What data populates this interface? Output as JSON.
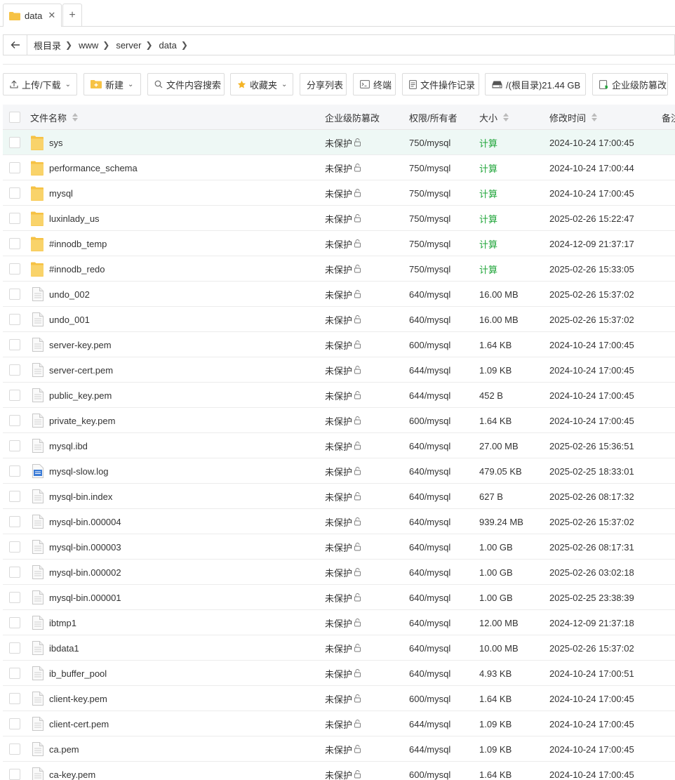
{
  "tab": {
    "label": "data",
    "close": "✕",
    "add": "+"
  },
  "breadcrumb": [
    "根目录",
    "www",
    "server",
    "data"
  ],
  "toolbar": {
    "upload": "上传/下载",
    "create": "新建",
    "search_content": "文件内容搜索",
    "favorites": "收藏夹",
    "share_list": "分享列表",
    "terminal": "终端",
    "operation_log": "文件操作记录",
    "disk": "/(根目录)21.44 GB",
    "tamper": "企业级防篡改"
  },
  "columns": {
    "name": "文件名称",
    "protection": "企业级防篡改",
    "permission": "权限/所有者",
    "size": "大小",
    "modified": "修改时间",
    "note": "备注"
  },
  "colors": {
    "accent": "#20a53a",
    "folder": "#f6c244",
    "selected_row": "#eef8f5"
  },
  "files": [
    {
      "name": "sys",
      "type": "folder",
      "protection": "未保护",
      "permission": "750/mysql",
      "size": "计算",
      "modified": "2024-10-24 17:00:45"
    },
    {
      "name": "performance_schema",
      "type": "folder",
      "protection": "未保护",
      "permission": "750/mysql",
      "size": "计算",
      "modified": "2024-10-24 17:00:44"
    },
    {
      "name": "mysql",
      "type": "folder",
      "protection": "未保护",
      "permission": "750/mysql",
      "size": "计算",
      "modified": "2024-10-24 17:00:45"
    },
    {
      "name": "luxinlady_us",
      "type": "folder",
      "protection": "未保护",
      "permission": "750/mysql",
      "size": "计算",
      "modified": "2025-02-26 15:22:47"
    },
    {
      "name": "#innodb_temp",
      "type": "folder",
      "protection": "未保护",
      "permission": "750/mysql",
      "size": "计算",
      "modified": "2024-12-09 21:37:17"
    },
    {
      "name": "#innodb_redo",
      "type": "folder",
      "protection": "未保护",
      "permission": "750/mysql",
      "size": "计算",
      "modified": "2025-02-26 15:33:05"
    },
    {
      "name": "undo_002",
      "type": "file",
      "protection": "未保护",
      "permission": "640/mysql",
      "size": "16.00 MB",
      "modified": "2025-02-26 15:37:02"
    },
    {
      "name": "undo_001",
      "type": "file",
      "protection": "未保护",
      "permission": "640/mysql",
      "size": "16.00 MB",
      "modified": "2025-02-26 15:37:02"
    },
    {
      "name": "server-key.pem",
      "type": "file",
      "protection": "未保护",
      "permission": "600/mysql",
      "size": "1.64 KB",
      "modified": "2024-10-24 17:00:45"
    },
    {
      "name": "server-cert.pem",
      "type": "file",
      "protection": "未保护",
      "permission": "644/mysql",
      "size": "1.09 KB",
      "modified": "2024-10-24 17:00:45"
    },
    {
      "name": "public_key.pem",
      "type": "file",
      "protection": "未保护",
      "permission": "644/mysql",
      "size": "452 B",
      "modified": "2024-10-24 17:00:45"
    },
    {
      "name": "private_key.pem",
      "type": "file",
      "protection": "未保护",
      "permission": "600/mysql",
      "size": "1.64 KB",
      "modified": "2024-10-24 17:00:45"
    },
    {
      "name": "mysql.ibd",
      "type": "file",
      "protection": "未保护",
      "permission": "640/mysql",
      "size": "27.00 MB",
      "modified": "2025-02-26 15:36:51"
    },
    {
      "name": "mysql-slow.log",
      "type": "log",
      "protection": "未保护",
      "permission": "640/mysql",
      "size": "479.05 KB",
      "modified": "2025-02-25 18:33:01"
    },
    {
      "name": "mysql-bin.index",
      "type": "file",
      "protection": "未保护",
      "permission": "640/mysql",
      "size": "627 B",
      "modified": "2025-02-26 08:17:32"
    },
    {
      "name": "mysql-bin.000004",
      "type": "file",
      "protection": "未保护",
      "permission": "640/mysql",
      "size": "939.24 MB",
      "modified": "2025-02-26 15:37:02"
    },
    {
      "name": "mysql-bin.000003",
      "type": "file",
      "protection": "未保护",
      "permission": "640/mysql",
      "size": "1.00 GB",
      "modified": "2025-02-26 08:17:31"
    },
    {
      "name": "mysql-bin.000002",
      "type": "file",
      "protection": "未保护",
      "permission": "640/mysql",
      "size": "1.00 GB",
      "modified": "2025-02-26 03:02:18"
    },
    {
      "name": "mysql-bin.000001",
      "type": "file",
      "protection": "未保护",
      "permission": "640/mysql",
      "size": "1.00 GB",
      "modified": "2025-02-25 23:38:39"
    },
    {
      "name": "ibtmp1",
      "type": "file",
      "protection": "未保护",
      "permission": "640/mysql",
      "size": "12.00 MB",
      "modified": "2024-12-09 21:37:18"
    },
    {
      "name": "ibdata1",
      "type": "file",
      "protection": "未保护",
      "permission": "640/mysql",
      "size": "10.00 MB",
      "modified": "2025-02-26 15:37:02"
    },
    {
      "name": "ib_buffer_pool",
      "type": "file",
      "protection": "未保护",
      "permission": "640/mysql",
      "size": "4.93 KB",
      "modified": "2024-10-24 17:00:51"
    },
    {
      "name": "client-key.pem",
      "type": "file",
      "protection": "未保护",
      "permission": "600/mysql",
      "size": "1.64 KB",
      "modified": "2024-10-24 17:00:45"
    },
    {
      "name": "client-cert.pem",
      "type": "file",
      "protection": "未保护",
      "permission": "644/mysql",
      "size": "1.09 KB",
      "modified": "2024-10-24 17:00:45"
    },
    {
      "name": "ca.pem",
      "type": "file",
      "protection": "未保护",
      "permission": "644/mysql",
      "size": "1.09 KB",
      "modified": "2024-10-24 17:00:45"
    },
    {
      "name": "ca-key.pem",
      "type": "file",
      "protection": "未保护",
      "permission": "600/mysql",
      "size": "1.64 KB",
      "modified": "2024-10-24 17:00:45"
    }
  ]
}
